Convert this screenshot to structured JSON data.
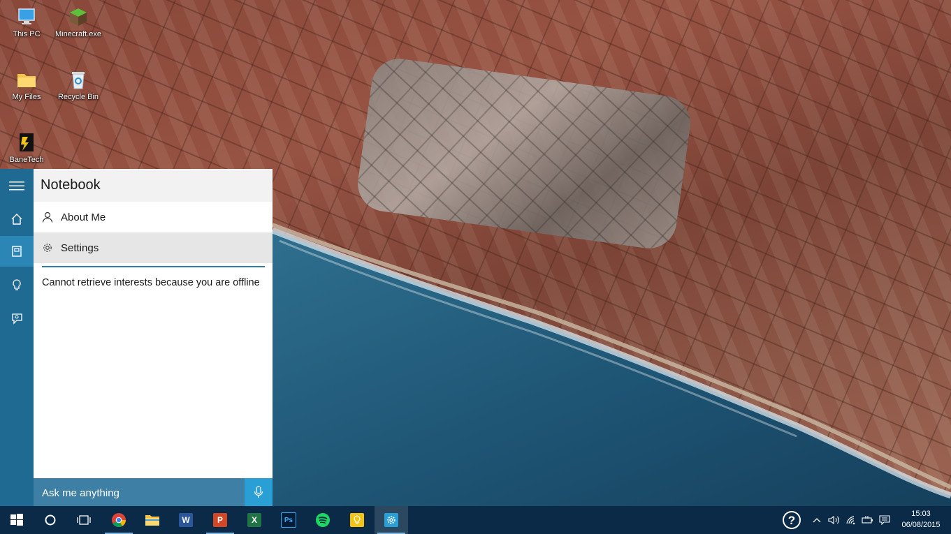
{
  "desktop": {
    "icons": [
      {
        "label": "This PC"
      },
      {
        "label": "Minecraft.exe"
      },
      {
        "label": "My Files"
      },
      {
        "label": "Recycle Bin"
      },
      {
        "label": "BaneTech"
      }
    ]
  },
  "cortana": {
    "title": "Notebook",
    "menu": [
      {
        "label": "About Me",
        "icon": "person-icon"
      },
      {
        "label": "Settings",
        "icon": "gear-icon"
      }
    ],
    "message": "Cannot retrieve interests because you are offline",
    "search_placeholder": "Ask me anything"
  },
  "taskbar": {
    "clock_time": "15:03",
    "clock_date": "06/08/2015"
  },
  "colors": {
    "rail": "#1f6a93",
    "accent": "#2a9fd6",
    "taskbar": "#0a2a47"
  }
}
